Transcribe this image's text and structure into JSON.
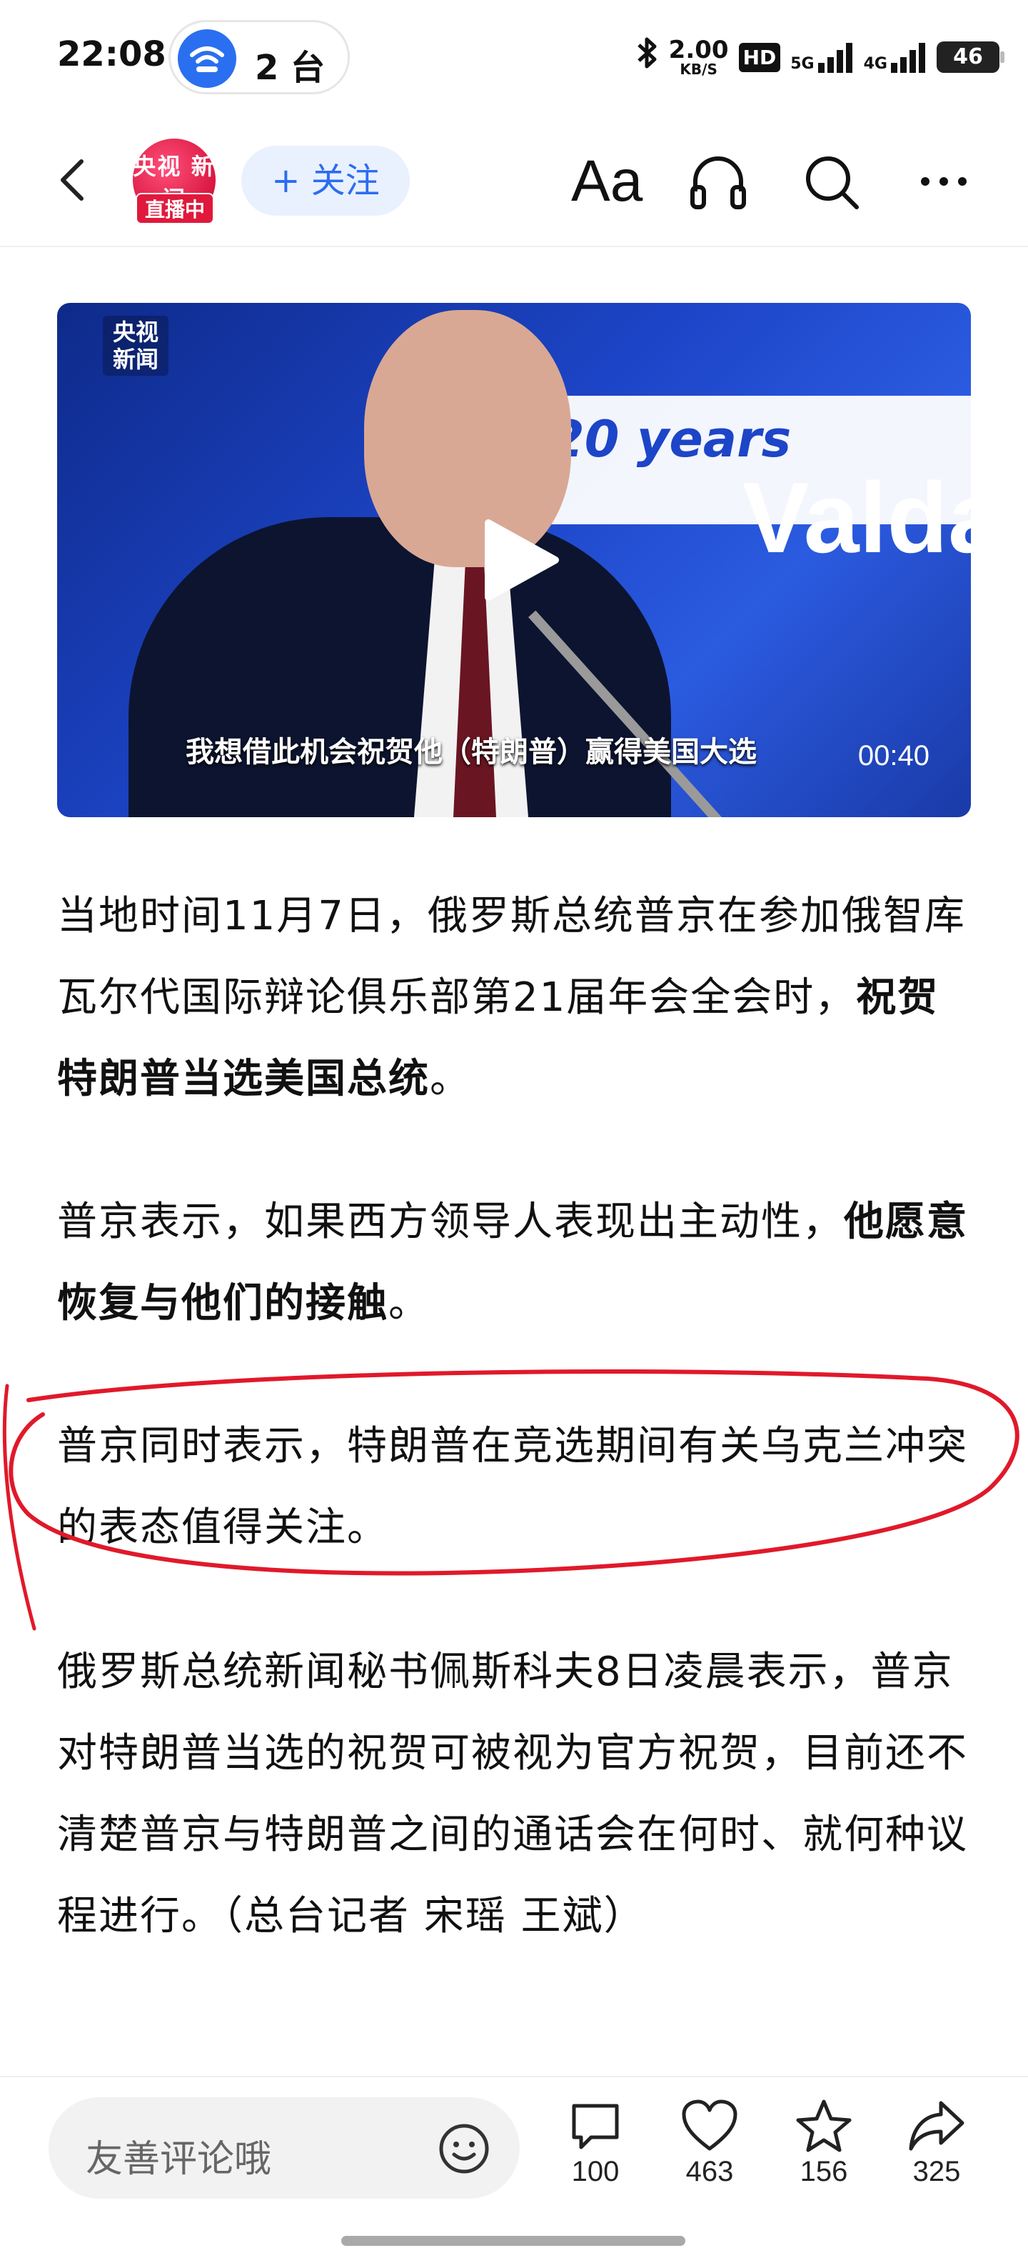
{
  "status_bar": {
    "time": "22:08",
    "cast_label": "2 台",
    "net_speed": "2.00",
    "net_unit": "KB/S",
    "hd_label": "HD",
    "signal_1": "5G",
    "signal_2": "4G",
    "battery": "46"
  },
  "header": {
    "channel_logo_text": "央视 新闻",
    "live_badge": "直播中",
    "follow_label": "+ 关注",
    "font_label": "Aa"
  },
  "video": {
    "logo_text": "央视 新闻",
    "banner_text": "20 years",
    "brand_text": "Valda",
    "subtitle": "我想借此机会祝贺他（特朗普）赢得美国大选",
    "duration": "00:40"
  },
  "article": {
    "p1_normal": "当地时间11月7日，俄罗斯总统普京在参加俄智库瓦尔代国际辩论俱乐部第21届年会全会时，",
    "p1_bold": "祝贺特朗普当选美国总统",
    "p1_end": "。",
    "p2_normal": "普京表示，如果西方领导人表现出主动性，",
    "p2_bold": "他愿意恢复与他们的接触",
    "p2_end": "。",
    "p3": "普京同时表示，特朗普在竞选期间有关乌克兰冲突的表态值得关注。",
    "p4": "俄罗斯总统新闻秘书佩斯科夫8日凌晨表示，普京对特朗普当选的祝贺可被视为官方祝贺，目前还不清楚普京与特朗普之间的通话会在何时、就何种议程进行。（总台记者 宋瑶 王斌）"
  },
  "bottom_bar": {
    "comment_placeholder": "友善评论哦",
    "comment_count": "100",
    "like_count": "463",
    "favorite_count": "156",
    "share_count": "325"
  },
  "colors": {
    "accent_blue": "#2d6cf0",
    "live_red": "#e0193c",
    "annotation_red": "#e0192a"
  }
}
